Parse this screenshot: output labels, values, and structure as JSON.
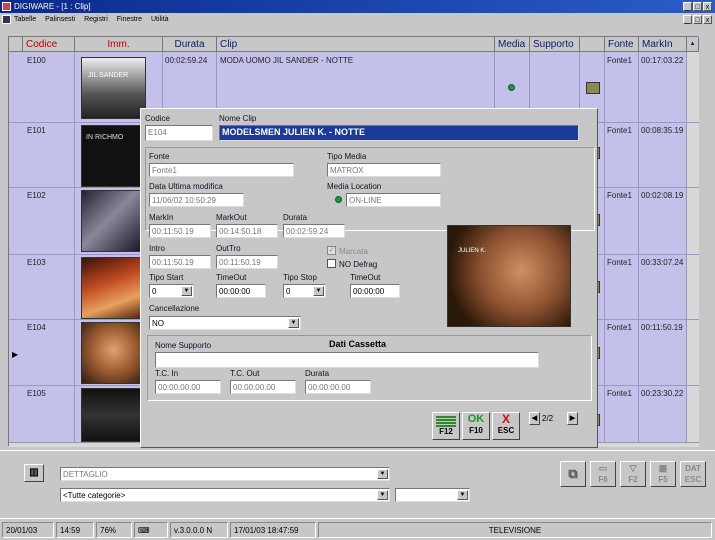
{
  "window": {
    "title": "DIGIWARE - [1 : Clip]",
    "min": "_",
    "max": "̅",
    "close": "x"
  },
  "menu": [
    "Tabelle",
    "Palinsesti",
    "Registri",
    "Finestre",
    "Utilità"
  ],
  "grid": {
    "headers": {
      "codice": "Codice",
      "imm": "Imm.",
      "durata": "Durata",
      "clip": "Clip",
      "media": "Media",
      "supporto": "Supporto",
      "fonte": "Fonte",
      "markin": "MarkIn"
    },
    "rows": [
      {
        "codice": "E100",
        "durata": "00:02:59.24",
        "clip": "MODA UOMO JIL SANDER - NOTTE",
        "fonte": "Fonte1",
        "markin": "00:17:03.22",
        "thumb_text": "JIL SANDER"
      },
      {
        "codice": "E101",
        "durata": "",
        "clip": "",
        "fonte": "Fonte1",
        "markin": "00:08:35.19",
        "thumb_text": "IN RICHMO"
      },
      {
        "codice": "E102",
        "durata": "",
        "clip": "",
        "fonte": "Fonte1",
        "markin": "00:02:08.19",
        "thumb_text": ""
      },
      {
        "codice": "E103",
        "durata": "",
        "clip": "",
        "fonte": "Fonte1",
        "markin": "00:33:07.24",
        "thumb_text": ""
      },
      {
        "codice": "E104",
        "durata": "",
        "clip": "",
        "fonte": "Fonte1",
        "markin": "00:11:50.19",
        "thumb_text": ""
      },
      {
        "codice": "E105",
        "durata": "",
        "clip": "",
        "fonte": "Fonte1",
        "markin": "00:23:30.22",
        "thumb_text": ""
      }
    ]
  },
  "dialog": {
    "codice_label": "Codice",
    "codice": "E104",
    "nome_clip_label": "Nome Clip",
    "nome_clip": "MODELSMEN JULIEN K. - NOTTE",
    "fonte_label": "Fonte",
    "fonte": "Fonte1",
    "tipo_media_label": "Tipo Media",
    "tipo_media": "MATROX",
    "data_label": "Data Ultima modifica",
    "data": "11/06/02 10:50:29",
    "media_location_label": "Media Location",
    "media_location": "ON-LINE",
    "markin_label": "MarkIn",
    "markin": "00:11:50.19",
    "markout_label": "MarkOut",
    "markout": "00:14:50.18",
    "durata_label": "Durata",
    "durata": "00:02:59.24",
    "intro_label": "Intro",
    "intro": "00:11:50.19",
    "outro_label": "OutTro",
    "outro": "00:11:50.19",
    "marcata_label": "Marcata",
    "nodefrag_label": "NO Defrag",
    "tipo_start_label": "Tipo Start",
    "tipo_start": "0",
    "timeout1_label": "TimeOut",
    "timeout1": "00:00:00",
    "tipo_stop_label": "Tipo Stop",
    "tipo_stop": "0",
    "timeout2_label": "TimeOut",
    "timeout2": "00:00:00",
    "cancellazione_label": "Cancellazione",
    "cancellazione": "NO",
    "cassetta_title": "Dati Cassetta",
    "nome_supporto_label": "Nome Supporto",
    "nome_supporto": "",
    "tcin_label": "T.C. In",
    "tcin": "00:00:00.00",
    "tcout_label": "T.C. Out",
    "tcout": "00:00:00.00",
    "cdurata_label": "Durata",
    "cdurata": "00:00:00.00",
    "preview_text": "JULIEN K.",
    "btn_save_icon": "lines-icon",
    "btn_save_key": "F12",
    "btn_ok_label": "OK",
    "btn_ok_key": "F10",
    "btn_esc_label": "X",
    "btn_esc_key": "ESC",
    "pager": "2/2"
  },
  "bottom": {
    "dettaglio": "DETTAGLIO",
    "categorie": "<Tutte categorie>",
    "f6": "F6",
    "f2": "F2",
    "f5": "F5",
    "esc": "ESC",
    "dat": "DAT"
  },
  "status": {
    "date": "20/01/03",
    "time": "14:59",
    "zoom": "76%",
    "version": "v.3.0.0.0 N",
    "datetime": "17/01/03 18:47:59",
    "channel": "TELEVISIONE"
  }
}
